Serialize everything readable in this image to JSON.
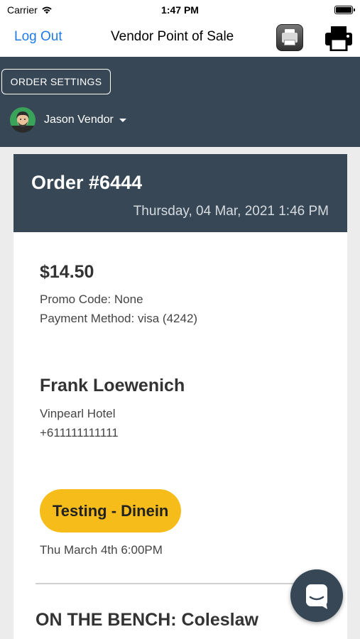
{
  "status_bar": {
    "carrier": "Carrier",
    "time": "1:47 PM"
  },
  "nav": {
    "logout_label": "Log Out",
    "title": "Vendor Point of Sale",
    "printer_status_icon": "printer-status-icon",
    "print_icon": "print-icon"
  },
  "header": {
    "order_settings_label": "ORDER SETTINGS",
    "vendor_name": "Jason Vendor"
  },
  "order": {
    "number": "Order #6444",
    "date": "Thursday, 04 Mar, 2021 1:46 PM",
    "amount": "$14.50",
    "promo": "Promo Code: None",
    "payment": "Payment Method: visa (4242)",
    "customer_name": "Frank Loewenich",
    "customer_location": "Vinpearl Hotel",
    "customer_phone": "+611111111111",
    "order_type": "Testing - Dinein",
    "scheduled_time": "Thu March 4th 6:00PM",
    "bench_title": "ON THE BENCH: Coleslaw"
  },
  "colors": {
    "header_bg": "#374755",
    "accent_link": "#1e7be6",
    "pill": "#f6bc1a",
    "avatar_bg": "#3aa35a"
  },
  "chat": {
    "icon": "chat-icon"
  }
}
